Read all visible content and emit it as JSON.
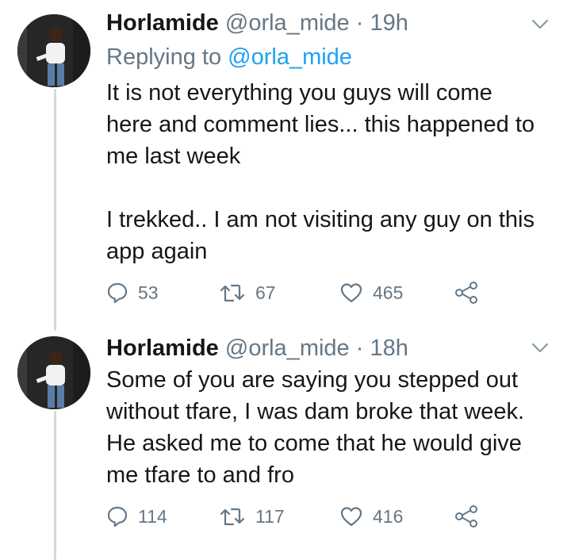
{
  "tweets": [
    {
      "name": "Horlamide",
      "handle": "@orla_mide",
      "separator": "·",
      "time": "19h",
      "replying_prefix": "Replying to",
      "replying_to": "@orla_mide",
      "lines": [
        "It is not everything you guys will come",
        "here and comment lies... this happened to",
        "me last week",
        "",
        "I trekked.. I am not visiting any guy on this",
        "app again"
      ],
      "replies": "53",
      "retweets": "67",
      "likes": "465"
    },
    {
      "name": "Horlamide",
      "handle": "@orla_mide",
      "separator": "·",
      "time": "18h",
      "lines": [
        "Some of you are saying you stepped out",
        "without tfare, I was dam broke that week.",
        "He asked me to come that he would give",
        "me tfare to and fro"
      ],
      "replies": "114",
      "retweets": "117",
      "likes": "416"
    }
  ],
  "icons": {
    "reply": "speech-bubble",
    "retweet": "two-arrows-loop",
    "like": "heart-outline",
    "share": "share-nodes",
    "menu": "chevron-down"
  },
  "colors": {
    "text": "#14171a",
    "muted": "#657786",
    "link": "#1da1f2",
    "thread_line": "#cfd9de"
  }
}
